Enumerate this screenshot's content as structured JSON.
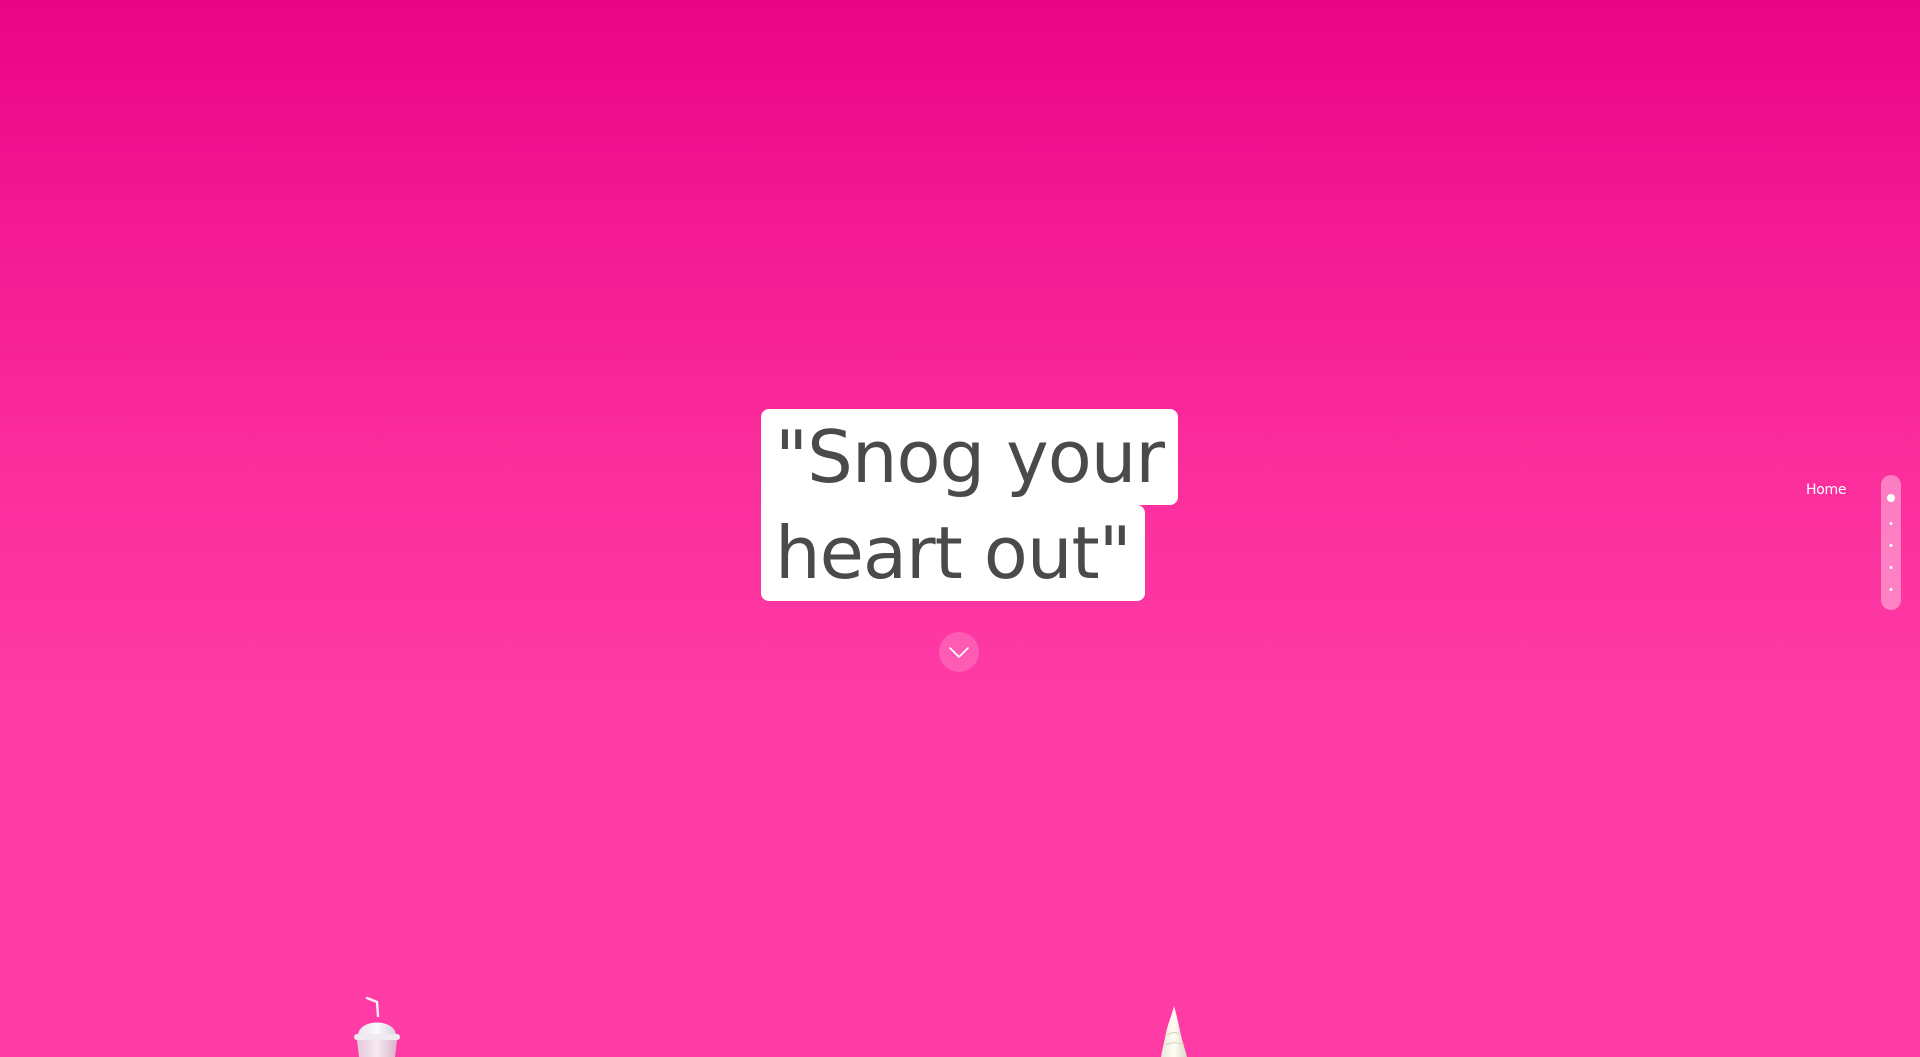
{
  "hero": {
    "headline_line1": "\"Snog your",
    "headline_line2": "heart out\""
  },
  "scroll_down": {
    "icon": "chevron-down-icon"
  },
  "side_nav": {
    "active_label": "Home",
    "dots": [
      {
        "section": "Home",
        "active": true
      },
      {
        "section": "section-2",
        "active": false
      },
      {
        "section": "section-3",
        "active": false
      },
      {
        "section": "section-4",
        "active": false
      },
      {
        "section": "section-5",
        "active": false
      }
    ]
  },
  "decorations": {
    "left_item": "frozen-yogurt-cup",
    "right_item": "soft-serve-cone"
  },
  "colors": {
    "background_top": "#ea0386",
    "background_bottom": "#ff3ca6",
    "headline_text": "#4a4a4a",
    "headline_bg": "#ffffff"
  }
}
